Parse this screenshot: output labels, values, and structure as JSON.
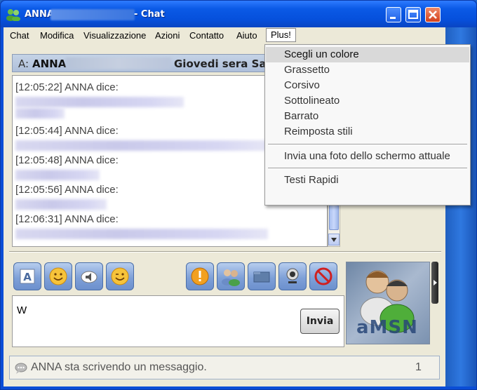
{
  "window": {
    "title_name": "ANNA",
    "title_suffix": "- Chat"
  },
  "menubar": {
    "items": [
      "Chat",
      "Modifica",
      "Visualizzazione",
      "Azioni",
      "Contatto",
      "Aiuto",
      "Plus!"
    ]
  },
  "header": {
    "to_label": "A:",
    "contact_name": "ANNA",
    "personal_message": "Giovedi sera Sal"
  },
  "chat": {
    "messages": [
      {
        "line": "[12:05:22] ANNA dice:"
      },
      {
        "line": "[12:05:44] ANNA dice:"
      },
      {
        "line": "[12:05:48] ANNA dice:"
      },
      {
        "line": "[12:05:56] ANNA dice:"
      },
      {
        "line": "[12:06:31] ANNA dice:"
      }
    ]
  },
  "toolbar": {
    "left_buttons": [
      "font-icon",
      "smiley-icon",
      "sound-icon",
      "wink-icon"
    ],
    "right_buttons": [
      "nudge-icon",
      "invite-icon",
      "send-file-icon",
      "webcam-icon",
      "block-icon"
    ]
  },
  "input": {
    "value": "W",
    "send_label": "Invia"
  },
  "avatar": {
    "label": "aMSN"
  },
  "status": {
    "text": "ANNA sta scrivendo un messaggio.",
    "count": "1"
  },
  "dropdown": {
    "group1": [
      "Scegli un colore",
      "Grassetto",
      "Corsivo",
      "Sottolineato",
      "Barrato",
      "Reimposta stili"
    ],
    "group2": [
      "Invia una foto dello schermo attuale"
    ],
    "group3": [
      "Testi Rapidi"
    ]
  },
  "colors": {
    "titlebar": "#0b5ae6",
    "client_bg": "#ece9d8",
    "menu_highlight": "#d9d9d9"
  }
}
